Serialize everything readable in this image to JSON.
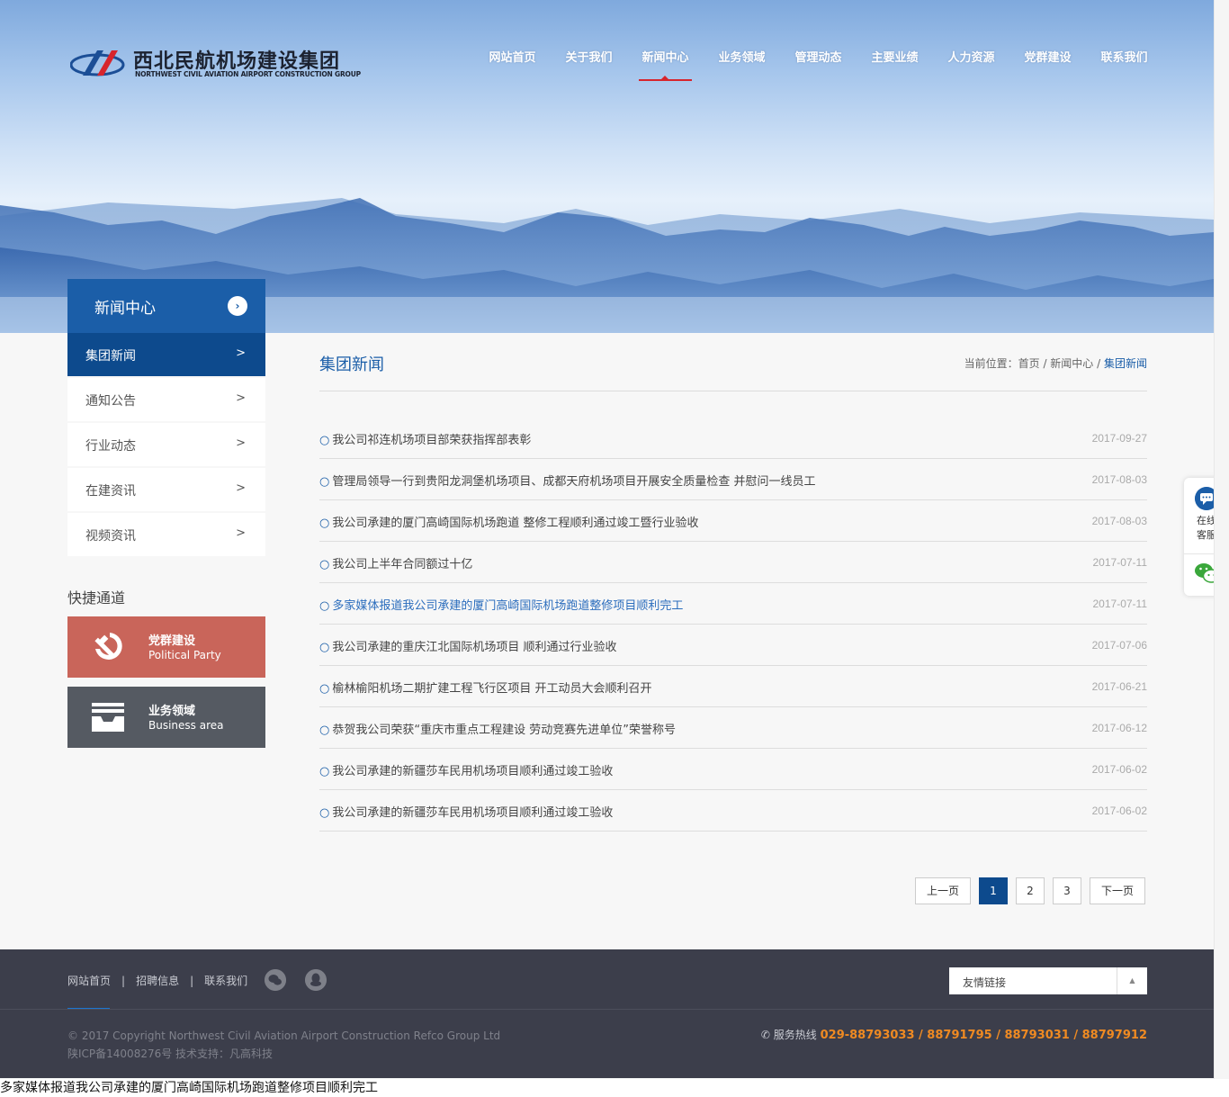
{
  "header": {
    "logo_cn": "西北民航机场建设集团",
    "logo_en": "NORTHWEST CIVIL AVIATION AIRPORT CONSTRUCTION GROUP",
    "nav": [
      {
        "label": "网站首页"
      },
      {
        "label": "关于我们"
      },
      {
        "label": "新闻中心",
        "active": true
      },
      {
        "label": "业务领域"
      },
      {
        "label": "管理动态"
      },
      {
        "label": "主要业绩"
      },
      {
        "label": "人力资源"
      },
      {
        "label": "党群建设"
      },
      {
        "label": "联系我们"
      }
    ]
  },
  "sidebar": {
    "title": "新闻中心",
    "title_icon": "chevron-right-circle-icon",
    "items": [
      {
        "label": "集团新闻",
        "arrow": ">",
        "active": true
      },
      {
        "label": "通知公告",
        "arrow": ">"
      },
      {
        "label": "行业动态",
        "arrow": ">"
      },
      {
        "label": "在建资讯",
        "arrow": ">"
      },
      {
        "label": "视频资讯",
        "arrow": ">"
      }
    ],
    "quick_title": "快捷通道",
    "quick": [
      {
        "cn": "党群建设",
        "en": "Political Party",
        "icon": "hammer-sickle-icon",
        "color": "#c9655a"
      },
      {
        "cn": "业务领域",
        "en": "Business area",
        "icon": "inbox-tray-icon",
        "color": "#555a62"
      }
    ]
  },
  "main": {
    "title": "集团新闻",
    "breadcrumb": {
      "prefix": "当前位置：",
      "home": "首页",
      "sep": " / ",
      "section": "新闻中心",
      "current": "集团新闻"
    },
    "news": [
      {
        "title": "我公司祁连机场项目部荣获指挥部表彰",
        "date": "2017-09-27"
      },
      {
        "title": "管理局领导一行到贵阳龙洞堡机场项目、成都天府机场项目开展安全质量检查 并慰问一线员工",
        "date": "2017-08-03"
      },
      {
        "title": "我公司承建的厦门高崎国际机场跑道 整修工程顺利通过竣工暨行业验收",
        "date": "2017-08-03"
      },
      {
        "title": "我公司上半年合同额过十亿",
        "date": "2017-07-11"
      },
      {
        "title": "多家媒体报道我公司承建的厦门高崎国际机场跑道整修项目顺利完工",
        "date": "2017-07-11",
        "highlight": true
      },
      {
        "title": "我公司承建的重庆江北国际机场项目 顺利通过行业验收",
        "date": "2017-07-06"
      },
      {
        "title": "榆林榆阳机场二期扩建工程飞行区项目 开工动员大会顺利召开",
        "date": "2017-06-21"
      },
      {
        "title": "恭贺我公司荣获“重庆市重点工程建设 劳动竞赛先进单位”荣誉称号",
        "date": "2017-06-12"
      },
      {
        "title": "我公司承建的新疆莎车民用机场项目顺利通过竣工验收",
        "date": "2017-06-02"
      },
      {
        "title": "我公司承建的新疆莎车民用机场项目顺利通过竣工验收",
        "date": "2017-06-02"
      }
    ],
    "bullet": "○",
    "pager": {
      "prev": "上一页",
      "pages": [
        "1",
        "2",
        "3"
      ],
      "current": "1",
      "next": "下一页"
    }
  },
  "footer": {
    "links": [
      "网站首页",
      "招聘信息",
      "联系我们"
    ],
    "link_sep": "|",
    "social_icons": [
      "wechat-icon",
      "qq-icon"
    ],
    "friend_links_label": "友情链接",
    "copyright": "© 2017 Copyright Northwest Civil Aviation Airport Construction Refco Group Ltd",
    "icp": "陕ICP备14008276号 技术支持：凡高科技",
    "hotline_label": "服务热线",
    "hotline_numbers": "029-88793033 / 88791795 / 88793031 / 88797912"
  },
  "float_service": {
    "online_label": "在线客服",
    "icons": [
      "chat-bubble-icon",
      "wechat-icon"
    ]
  },
  "bottom_caption": "多家媒体报道我公司承建的厦门高崎国际机场跑道整修项目顺利完工",
  "colors": {
    "primary": "#1b5ea8",
    "dark_primary": "#0d4a8d",
    "accent_red": "#d7252d",
    "hotline": "#ef8a22",
    "footer_bg": "#3c3e4b"
  }
}
